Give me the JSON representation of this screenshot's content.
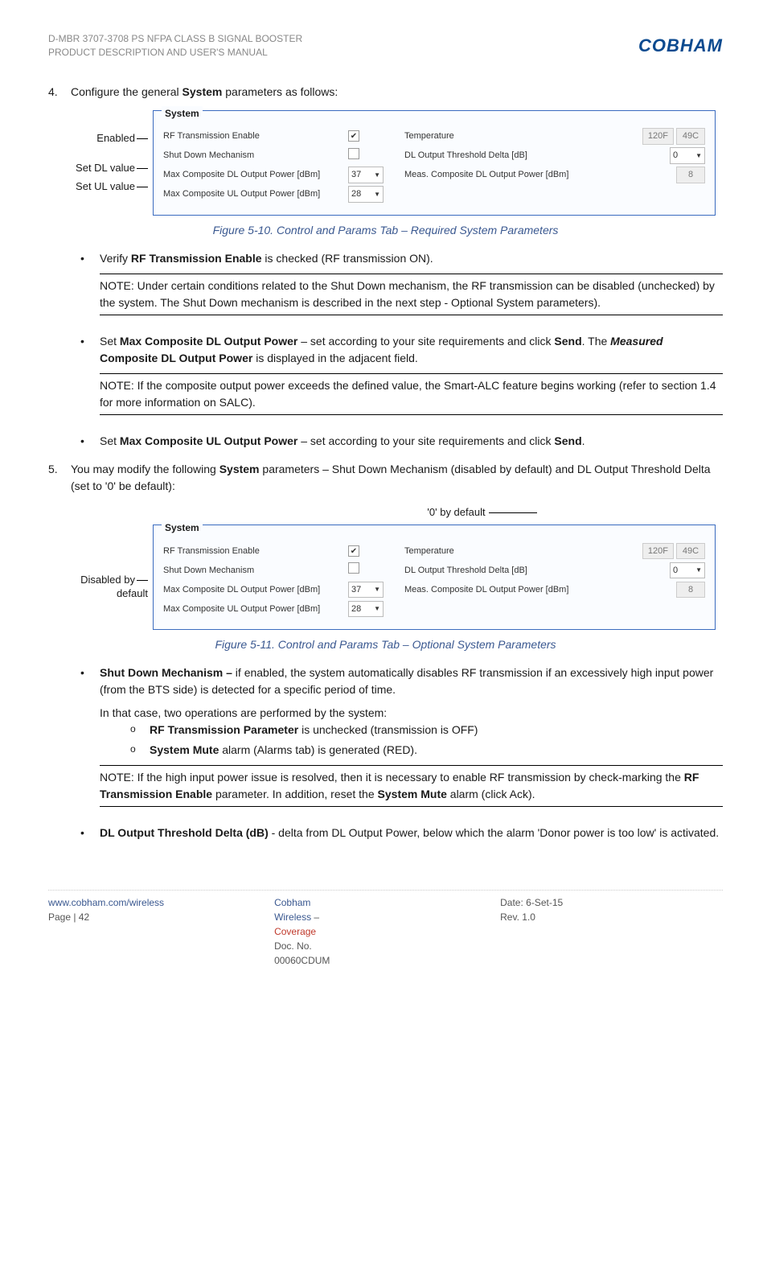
{
  "header": {
    "line1": "D-MBR 3707-3708 PS NFPA CLASS B SIGNAL BOOSTER",
    "line2": "PRODUCT DESCRIPTION AND USER'S MANUAL",
    "logo": "COBHAM"
  },
  "step4": {
    "num": "4.",
    "text_lead": "Configure the general ",
    "text_bold": "System",
    "text_tail": " parameters as follows:"
  },
  "ann1": {
    "enabled": "Enabled",
    "dl": "Set DL value",
    "ul": "Set UL value"
  },
  "system_panel": {
    "legend": "System",
    "left": {
      "r1": "RF Transmission Enable",
      "r2": "Shut Down Mechanism",
      "r3": "Max Composite DL Output Power [dBm]",
      "r4": "Max Composite UL Output Power [dBm]",
      "v3": "37",
      "v4": "28"
    },
    "right": {
      "r1": "Temperature",
      "r2": "DL Output Threshold Delta [dB]",
      "r3": "Meas. Composite DL Output Power [dBm]",
      "v1a": "120F",
      "v1b": "49C",
      "v2": "0",
      "v3": "8"
    }
  },
  "caption1": "Figure 5-10. Control and Params Tab – Required System Parameters",
  "bullets4": {
    "b1": {
      "lead": "Verify ",
      "bold": "RF Transmission Enable",
      "tail": " is checked (RF transmission ON)."
    },
    "note1": "NOTE: Under certain conditions related to the Shut Down mechanism, the RF transmission can be disabled (unchecked) by the system.   The Shut Down mechanism is described in the next step - Optional System parameters).",
    "b2": {
      "seg1": "Set ",
      "seg2": "Max Composite DL Output Power",
      "seg3": " – set according to your site requirements and click ",
      "seg4": "Send",
      "seg5": ". The ",
      "seg6": "Measured",
      "seg7": " ",
      "seg8": "Composite DL Output Power",
      "seg9": " is displayed in the adjacent field."
    },
    "note2": "NOTE: If the composite output power exceeds the defined value, the Smart-ALC feature begins working (refer to section 1.4 for more information on SALC).",
    "b3": {
      "seg1": "Set ",
      "seg2": "Max Composite UL Output Power",
      "seg3": " – set according to your site requirements and click ",
      "seg4": "Send",
      "seg5": "."
    }
  },
  "step5": {
    "num": "5.",
    "seg1": "You may modify the following ",
    "seg2": "System",
    "seg3": " parameters – Shut Down Mechanism (disabled by default) and DL Output Threshold Delta (set to '0' be default):"
  },
  "ann2": {
    "top": "'0' by default",
    "side1": "Disabled by",
    "side2": "default"
  },
  "caption2": "Figure 5-11. Control and Params Tab – Optional System Parameters",
  "bullets5": {
    "b1": {
      "seg1": "Shut Down Mechanism –",
      "seg2": " if enabled, the system automatically disables RF transmission if an excessively high input power (from the BTS side) is detected for a specific period of time.",
      "seg3": "In that case, two operations are performed by the system:"
    },
    "c1": {
      "bold": "RF Transmission Parameter",
      "tail": " is unchecked (transmission is OFF)"
    },
    "c2": {
      "bold": "System Mute",
      "tail": " alarm (Alarms tab) is generated (RED)."
    },
    "note": {
      "seg1": "NOTE:  If the high input power issue is resolved, then it is necessary to enable RF transmission by check-marking the ",
      "seg2": "RF Transmission Enable",
      "seg3": " parameter. In addition, reset the ",
      "seg4": "System Mute",
      "seg5": " alarm (click Ack)."
    },
    "b2": {
      "bold": "DL Output Threshold Delta (dB)",
      "tail": " - delta from DL Output Power, below which the alarm 'Donor power is too low' is activated."
    }
  },
  "footer": {
    "l1": "www.cobham.com/wireless",
    "l2": "Page | 42",
    "m1a": "Cobham Wireless",
    "m1b": " – ",
    "m1c": "Coverage",
    "m2": "Doc. No. 00060CDUM",
    "r1": "Date: 6-Set-15",
    "r2": "Rev. 1.0"
  },
  "bullet_char": "•",
  "circ_char": "o"
}
